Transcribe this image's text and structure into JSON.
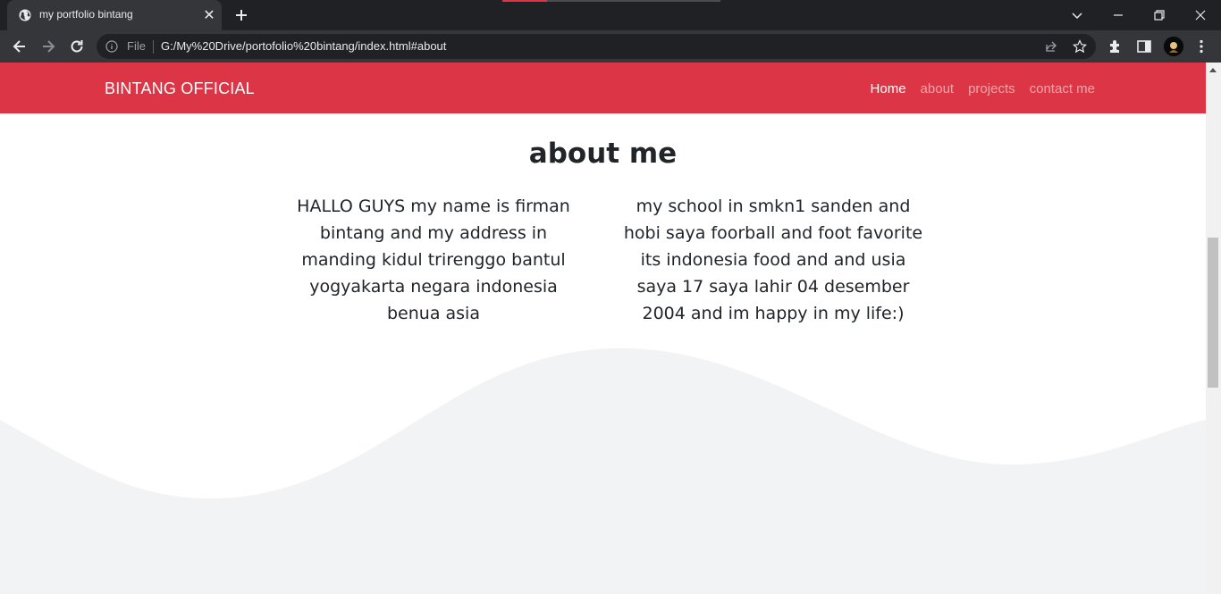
{
  "browser": {
    "tab": {
      "title": "my portfolio bintang"
    },
    "omnibox": {
      "scheme_label": "File",
      "url": "G:/My%20Drive/portofolio%20bintang/index.html#about"
    }
  },
  "page": {
    "navbar": {
      "brand": "BINTANG OFFICIAL",
      "links": [
        {
          "label": "Home",
          "active": true
        },
        {
          "label": "about",
          "active": false
        },
        {
          "label": "projects",
          "active": false
        },
        {
          "label": "contact me",
          "active": false
        }
      ]
    },
    "about": {
      "title": "about me",
      "paragraph_left": "HALLO GUYS my name is firman bintang and my address in manding kidul trirenggo bantul yogyakarta negara indonesia benua asia",
      "paragraph_right": "my school in smkn1 sanden and hobi saya foorball and foot favorite its indonesia food and and usia saya 17 saya lahir 04 desember 2004 and im happy in my life:)"
    }
  },
  "colors": {
    "navbar": "#dc3545",
    "wave": "#f2f3f5",
    "text": "#212529"
  },
  "icons": [
    "globe-icon",
    "close-icon",
    "plus-icon",
    "chevron-down-icon",
    "minimize-icon",
    "restore-icon",
    "window-close-icon",
    "back-arrow-icon",
    "forward-arrow-icon",
    "reload-icon",
    "info-icon",
    "share-icon",
    "star-icon",
    "extensions-icon",
    "side-panel-icon",
    "menu-dots-icon"
  ]
}
